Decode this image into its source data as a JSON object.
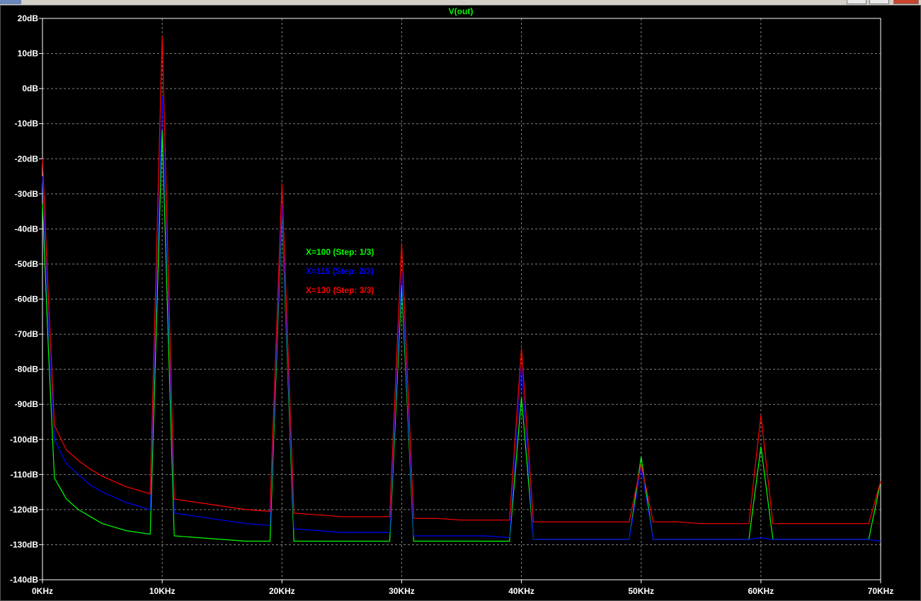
{
  "plot": {
    "trace_title": "V(out)",
    "trace_title_color": "#00ff00",
    "background": "#000000",
    "grid_color": "#808080",
    "axis_color": "#ffffff"
  },
  "window_controls": [
    {
      "name": "minimize",
      "icon": "minimize-icon"
    },
    {
      "name": "maximize",
      "icon": "maximize-icon"
    },
    {
      "name": "close",
      "icon": "close-icon"
    }
  ],
  "chart_data": {
    "type": "line",
    "title": "V(out)",
    "xlabel": "",
    "ylabel": "",
    "xlim": [
      0,
      70
    ],
    "ylim": [
      -140,
      20
    ],
    "grid": true,
    "x_ticks": [
      "0KHz",
      "10KHz",
      "20KHz",
      "30KHz",
      "40KHz",
      "50KHz",
      "60KHz",
      "70KHz"
    ],
    "y_ticks": [
      "20dB",
      "10dB",
      "0dB",
      "-10dB",
      "-20dB",
      "-30dB",
      "-40dB",
      "-50dB",
      "-60dB",
      "-70dB",
      "-80dB",
      "-90dB",
      "-100dB",
      "-110dB",
      "-120dB",
      "-130dB",
      "-140dB"
    ],
    "legend": [
      {
        "label": "X=100  (Step: 1/3)",
        "color": "#00ff00"
      },
      {
        "label": "X=115  (Step: 2/3)",
        "color": "#0000ff"
      },
      {
        "label": "X=130  (Step: 3/3)",
        "color": "#ff0000"
      }
    ],
    "series": [
      {
        "color": "#00ff00",
        "points": [
          [
            0,
            -33
          ],
          [
            0.5,
            -75
          ],
          [
            1,
            -111
          ],
          [
            2,
            -117
          ],
          [
            3,
            -120
          ],
          [
            4,
            -122
          ],
          [
            5,
            -124
          ],
          [
            6,
            -125
          ],
          [
            7,
            -126
          ],
          [
            8,
            -126.5
          ],
          [
            9,
            -127
          ],
          [
            10,
            -12
          ],
          [
            11,
            -127.5
          ],
          [
            13,
            -128
          ],
          [
            15,
            -128.5
          ],
          [
            17,
            -129
          ],
          [
            19,
            -129
          ],
          [
            20,
            -35
          ],
          [
            21,
            -129
          ],
          [
            23,
            -129
          ],
          [
            25,
            -129
          ],
          [
            27,
            -129
          ],
          [
            29,
            -129
          ],
          [
            30,
            -56
          ],
          [
            31,
            -129
          ],
          [
            33,
            -129
          ],
          [
            35,
            -129
          ],
          [
            37,
            -129
          ],
          [
            39,
            -129
          ],
          [
            40,
            -88
          ],
          [
            41,
            -128.5
          ],
          [
            43,
            -128.5
          ],
          [
            45,
            -128.5
          ],
          [
            47,
            -128.5
          ],
          [
            49,
            -128.5
          ],
          [
            50,
            -105
          ],
          [
            51,
            -128.5
          ],
          [
            53,
            -128.5
          ],
          [
            55,
            -128.5
          ],
          [
            57,
            -128.5
          ],
          [
            59,
            -128.5
          ],
          [
            60,
            -102
          ],
          [
            61,
            -128.5
          ],
          [
            63,
            -128.5
          ],
          [
            65,
            -128.5
          ],
          [
            67,
            -128.5
          ],
          [
            69,
            -128.5
          ],
          [
            70,
            -112
          ]
        ]
      },
      {
        "color": "#0000ff",
        "points": [
          [
            0,
            -25
          ],
          [
            0.5,
            -68
          ],
          [
            1,
            -100
          ],
          [
            2,
            -107
          ],
          [
            3,
            -110
          ],
          [
            4,
            -113
          ],
          [
            5,
            -115
          ],
          [
            6,
            -116.5
          ],
          [
            7,
            -118
          ],
          [
            8,
            -119
          ],
          [
            9,
            -120
          ],
          [
            10,
            -2
          ],
          [
            11,
            -121
          ],
          [
            13,
            -122
          ],
          [
            15,
            -123
          ],
          [
            17,
            -124
          ],
          [
            19,
            -124.5
          ],
          [
            20,
            -33
          ],
          [
            21,
            -125.5
          ],
          [
            23,
            -126
          ],
          [
            25,
            -126.5
          ],
          [
            27,
            -126.5
          ],
          [
            29,
            -126.5
          ],
          [
            30,
            -52
          ],
          [
            31,
            -127.5
          ],
          [
            33,
            -127.5
          ],
          [
            35,
            -127.5
          ],
          [
            37,
            -127.5
          ],
          [
            39,
            -128
          ],
          [
            40,
            -79
          ],
          [
            41,
            -128.5
          ],
          [
            43,
            -128.5
          ],
          [
            45,
            -128.5
          ],
          [
            47,
            -128.5
          ],
          [
            49,
            -128.5
          ],
          [
            50,
            -108
          ],
          [
            51,
            -128.5
          ],
          [
            53,
            -128.5
          ],
          [
            55,
            -128.5
          ],
          [
            57,
            -128.5
          ],
          [
            59,
            -128.5
          ],
          [
            60,
            -128
          ],
          [
            61,
            -128.5
          ],
          [
            63,
            -128.5
          ],
          [
            65,
            -128.5
          ],
          [
            67,
            -128.5
          ],
          [
            69,
            -128.5
          ],
          [
            70,
            -129
          ]
        ]
      },
      {
        "color": "#ff0000",
        "points": [
          [
            0,
            -20
          ],
          [
            0.5,
            -60
          ],
          [
            1,
            -96
          ],
          [
            2,
            -103
          ],
          [
            3,
            -106
          ],
          [
            4,
            -108.5
          ],
          [
            5,
            -110.5
          ],
          [
            6,
            -112
          ],
          [
            7,
            -113.5
          ],
          [
            8,
            -114.5
          ],
          [
            9,
            -115.5
          ],
          [
            10,
            15
          ],
          [
            11,
            -117
          ],
          [
            13,
            -118
          ],
          [
            15,
            -119
          ],
          [
            17,
            -120
          ],
          [
            19,
            -120.5
          ],
          [
            20,
            -27
          ],
          [
            21,
            -121
          ],
          [
            23,
            -121.5
          ],
          [
            25,
            -122
          ],
          [
            27,
            -122
          ],
          [
            29,
            -122
          ],
          [
            30,
            -44
          ],
          [
            31,
            -122.5
          ],
          [
            33,
            -122.5
          ],
          [
            35,
            -123
          ],
          [
            37,
            -123
          ],
          [
            39,
            -123
          ],
          [
            40,
            -74
          ],
          [
            41,
            -123.5
          ],
          [
            43,
            -123.5
          ],
          [
            45,
            -123.5
          ],
          [
            47,
            -123.5
          ],
          [
            49,
            -123.5
          ],
          [
            50,
            -107
          ],
          [
            51,
            -123.5
          ],
          [
            53,
            -123.5
          ],
          [
            55,
            -124
          ],
          [
            57,
            -124
          ],
          [
            59,
            -124
          ],
          [
            60,
            -93
          ],
          [
            61,
            -124
          ],
          [
            63,
            -124
          ],
          [
            65,
            -124
          ],
          [
            67,
            -124
          ],
          [
            69,
            -124
          ],
          [
            70,
            -112
          ]
        ]
      }
    ]
  }
}
